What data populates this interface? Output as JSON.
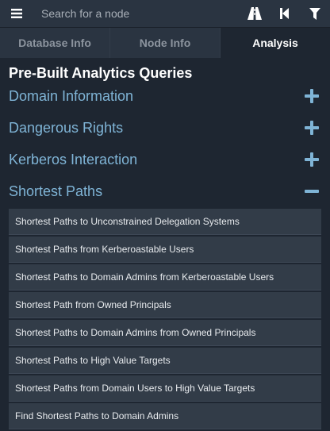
{
  "search": {
    "placeholder": "Search for a node"
  },
  "icons": {
    "menu": "hamburger-menu-icon",
    "pathfinding": "road-icon",
    "back": "step-backward-icon",
    "filter": "filter-icon"
  },
  "tabs": [
    {
      "label": "Database Info",
      "active": false
    },
    {
      "label": "Node Info",
      "active": false
    },
    {
      "label": "Analysis",
      "active": true
    }
  ],
  "analysis": {
    "title": "Pre-Built Analytics Queries",
    "categories": [
      {
        "label": "Domain Information",
        "expanded": false
      },
      {
        "label": "Dangerous Rights",
        "expanded": false
      },
      {
        "label": "Kerberos Interaction",
        "expanded": false
      },
      {
        "label": "Shortest Paths",
        "expanded": true
      }
    ],
    "queries": [
      "Shortest Paths to Unconstrained Delegation Systems",
      "Shortest Paths from Kerberoastable Users",
      "Shortest Paths to Domain Admins from Kerberoastable Users",
      "Shortest Path from Owned Principals",
      "Shortest Paths to Domain Admins from Owned Principals",
      "Shortest Paths to High Value Targets",
      "Shortest Paths from Domain Users to High Value Targets",
      "Find Shortest Paths to Domain Admins"
    ]
  },
  "colors": {
    "background": "#1e2631",
    "panel": "#2a3441",
    "accent": "#7fb4d6",
    "query_bg": "#323c48"
  }
}
